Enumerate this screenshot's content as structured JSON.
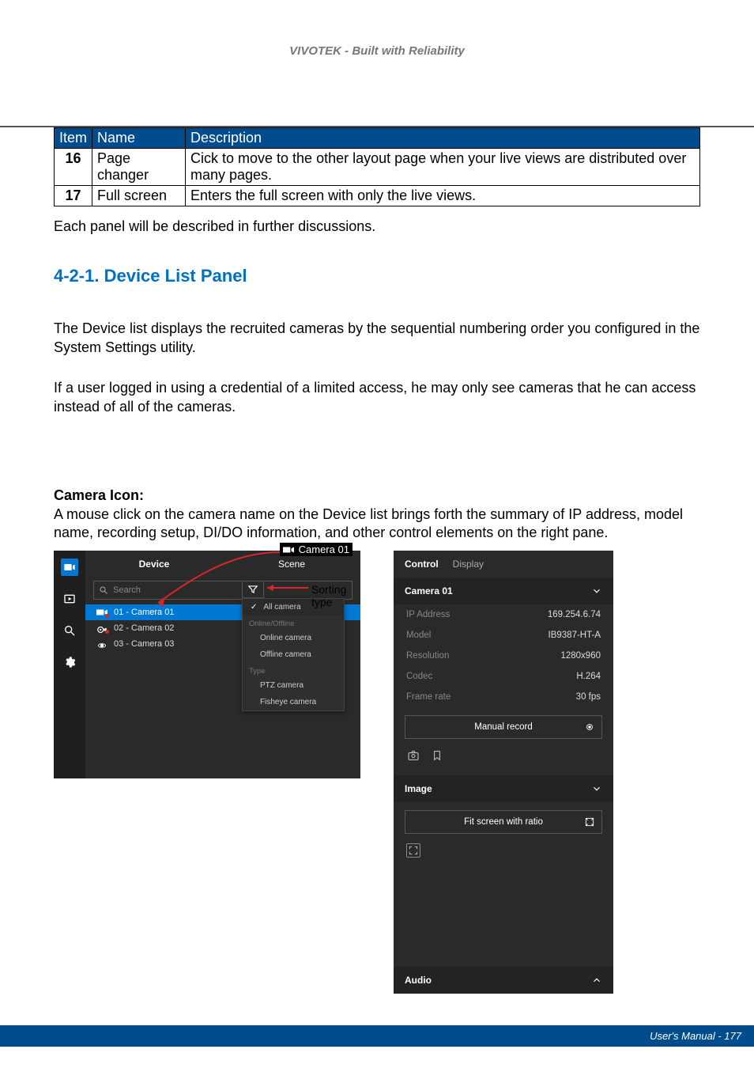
{
  "brand": "VIVOTEK - Built with Reliability",
  "table": {
    "headers": [
      "Item",
      "Name",
      "Description"
    ],
    "rows": [
      {
        "item": "16",
        "name": "Page changer",
        "desc": "Cick to move to the other layout page when your live views are distributed over many pages."
      },
      {
        "item": "17",
        "name": "Full screen",
        "desc": "Enters the full screen with only the live views."
      }
    ]
  },
  "para1": "Each panel will be described in further discussions.",
  "section_title": "4-2-1. Device List Panel",
  "para2": "The Device list displays the recruited cameras by the sequential numbering order you configured in the System Settings utility.",
  "para3": "If a user logged in using a credential of a limited access, he may only see cameras that he can access instead of all of the cameras.",
  "camera_icon_head": "Camera Icon:",
  "camera_icon_text": "A mouse click on the camera name on the Device list brings forth the summary of IP address, model name, recording setup, DI/DO information, and other control elements on the right pane.",
  "device_panel": {
    "tabs": [
      "Device",
      "Scene"
    ],
    "search_placeholder": "Search",
    "anno_camera01": "Camera 01",
    "anno_sorting": "Sorting type",
    "items": [
      {
        "label": "01 - Camera 01",
        "status": "rec",
        "type": "box"
      },
      {
        "label": "02 - Camera 02",
        "status": "rec",
        "type": "ptz"
      },
      {
        "label": "03 - Camera 03",
        "status": "",
        "type": "fisheye"
      }
    ],
    "filter": {
      "all": "All camera",
      "sect1": "Online/Offline",
      "opt1": "Online camera",
      "opt2": "Offline camera",
      "sect2": "Type",
      "opt3": "PTZ camera",
      "opt4": "Fisheye camera"
    }
  },
  "control_panel": {
    "tabs": [
      "Control",
      "Display"
    ],
    "title": "Camera 01",
    "kv": [
      {
        "k": "IP Address",
        "v": "169.254.6.74"
      },
      {
        "k": "Model",
        "v": "IB9387-HT-A"
      },
      {
        "k": "Resolution",
        "v": "1280x960"
      },
      {
        "k": "Codec",
        "v": "H.264"
      },
      {
        "k": "Frame rate",
        "v": "30 fps"
      }
    ],
    "manual_record": "Manual record",
    "image": "Image",
    "fit_screen": "Fit screen with ratio",
    "audio": "Audio"
  },
  "footer": "User's Manual - 177"
}
